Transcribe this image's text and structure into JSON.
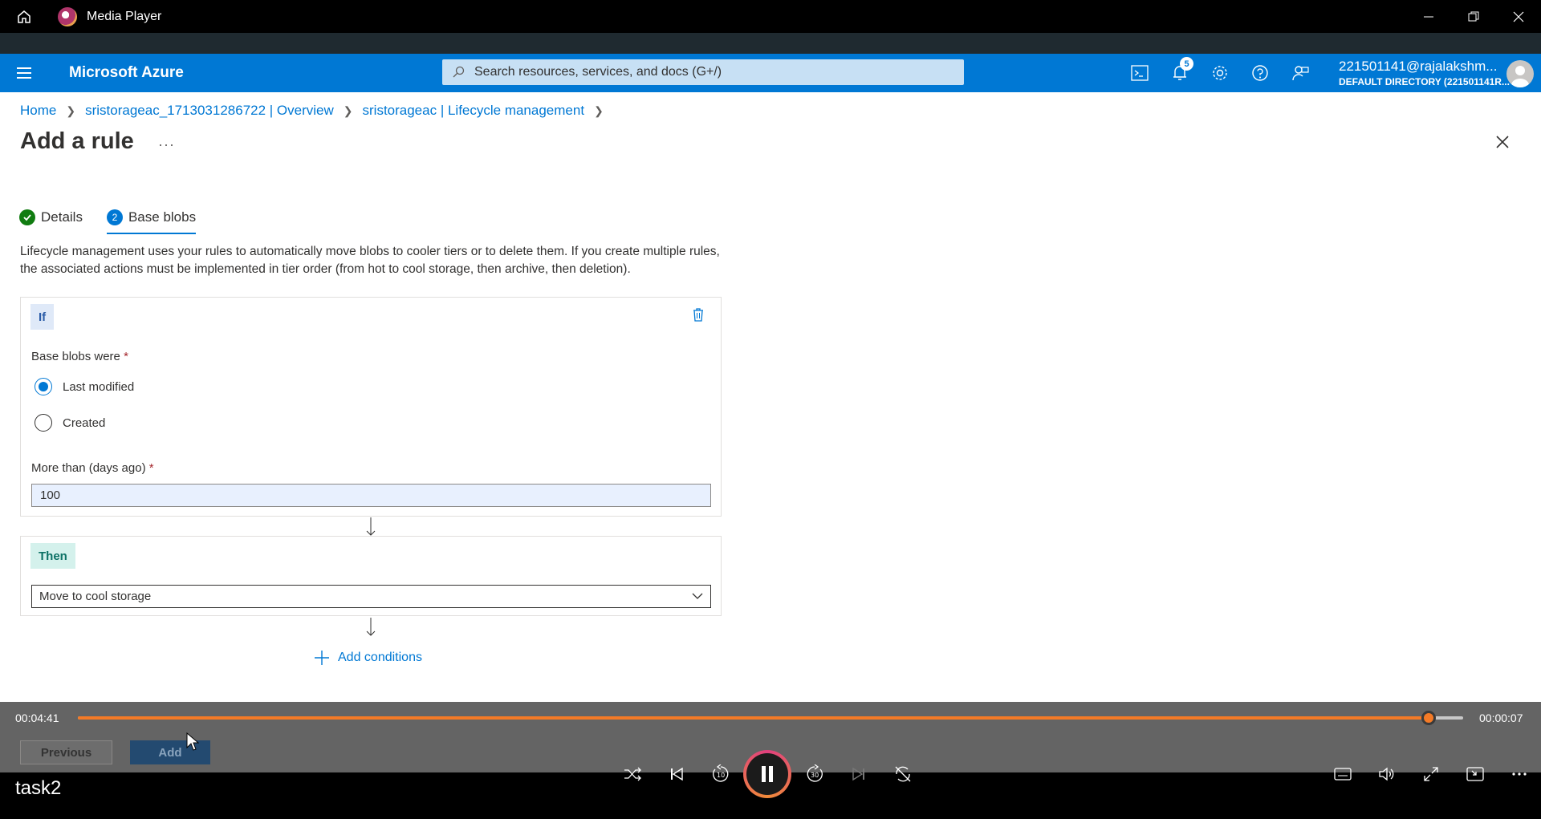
{
  "player": {
    "title": "Media Player",
    "media_name": "task2",
    "time_current": "00:04:41",
    "time_remaining": "00:00:07",
    "progress": 0.975
  },
  "azure": {
    "brand": "Microsoft Azure",
    "search_placeholder": "Search resources, services, and docs (G+/)",
    "notifications_count": "5",
    "account_user": "221501141@rajalakshm...",
    "account_directory": "DEFAULT DIRECTORY (221501141R..."
  },
  "breadcrumb": {
    "home": "Home",
    "overview": "sristorageac_1713031286722 | Overview",
    "lifecycle": "sristorageac | Lifecycle management"
  },
  "page": {
    "title": "Add a rule",
    "more": "···"
  },
  "tabs": [
    {
      "label": "Details",
      "state": "done"
    },
    {
      "label": "Base blobs",
      "number": "2",
      "state": "active"
    }
  ],
  "description": "Lifecycle management uses your rules to automatically move blobs to cooler tiers or to delete them. If you create multiple rules, the associated actions must be implemented in tier order (from hot to cool storage, then archive, then deletion).",
  "if_block": {
    "tag": "If",
    "base_blobs_label": "Base blobs were",
    "options": [
      "Last modified",
      "Created"
    ],
    "selected": "Last modified",
    "days_label": "More than (days ago)",
    "days_value": "100",
    "required_mark": "*"
  },
  "then_block": {
    "tag": "Then",
    "action_value": "Move to cool storage"
  },
  "add_conditions_label": "Add conditions",
  "footer": {
    "previous_label": "Previous",
    "add_label": "Add"
  },
  "colors": {
    "azure_blue": "#0078d4",
    "player_accent": "#f47a26"
  }
}
